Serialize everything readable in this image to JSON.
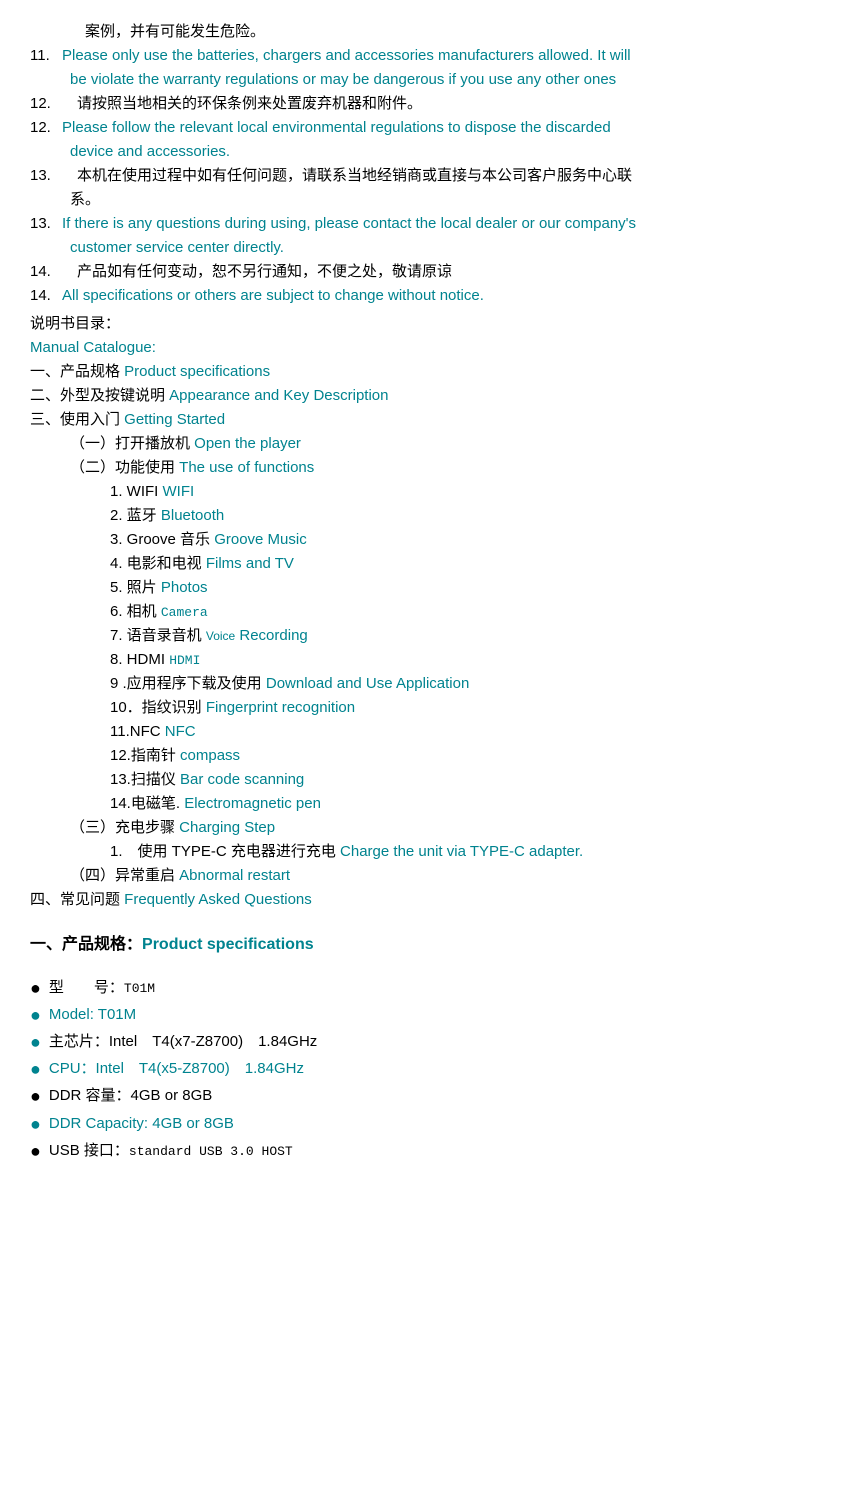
{
  "lines": [
    {
      "id": "l1",
      "indent": 0,
      "text_black": "　案例，并有可能发生危险。",
      "text_teal": ""
    },
    {
      "id": "l2",
      "indent": 0,
      "num": "11.",
      "text_black": "Please only use the batteries, chargers and accessories manufacturers allowed. It will",
      "text_teal": "",
      "color": "teal"
    },
    {
      "id": "l3",
      "indent": 1,
      "text_black": "",
      "text_teal": "be violate the warranty regulations or may be dangerous if you use any other ones",
      "color": "teal"
    },
    {
      "id": "l4",
      "indent": 0,
      "num": "12.",
      "text_black": "　请按照当地相关的环保条例来处置废弃机器和附件。",
      "text_teal": ""
    },
    {
      "id": "l5",
      "indent": 0,
      "num": "12.",
      "text_black": "Please follow the relevant local environmental regulations to dispose the discarded",
      "text_teal": "",
      "color": "teal"
    },
    {
      "id": "l6",
      "indent": 1,
      "text_black": "",
      "text_teal": "device and accessories.",
      "color": "teal"
    },
    {
      "id": "l7",
      "indent": 0,
      "num": "13.",
      "text_black": "　本机在使用过程中如有任何问题，请联系当地经销商或直接与本公司客户服务中心联",
      "text_teal": ""
    },
    {
      "id": "l8",
      "indent": 1,
      "text_black": "系。",
      "text_teal": ""
    },
    {
      "id": "l9",
      "indent": 0,
      "num": "13.",
      "text_black": "If there is any questions during using, please contact the local dealer or our company's",
      "text_teal": "",
      "color": "teal"
    },
    {
      "id": "l10",
      "indent": 1,
      "text_black": "",
      "text_teal": "customer service center directly.",
      "color": "teal"
    },
    {
      "id": "l11",
      "indent": 0,
      "num": "14.",
      "text_black": "　产品如有任何变动，恕不另行通知，不便之处，敬请原谅",
      "text_teal": ""
    },
    {
      "id": "l12",
      "indent": 0,
      "num": "14.",
      "text_black": "All specifications or others are subject to change without notice.",
      "text_teal": "",
      "color": "teal"
    },
    {
      "id": "l13",
      "indent": 0,
      "text_black": "说明书目录：",
      "text_teal": ""
    },
    {
      "id": "l14",
      "indent": 0,
      "text_black": "",
      "text_teal": "Manual Catalogue:",
      "color": "teal"
    },
    {
      "id": "l15",
      "indent": 0,
      "text_black": "一、产品规格  ",
      "text_teal": "Product specifications"
    },
    {
      "id": "l16",
      "indent": 0,
      "text_black": "二、外型及按键说明 ",
      "text_teal": "Appearance and Key Description"
    },
    {
      "id": "l17",
      "indent": 0,
      "text_black": "三、使用入门   ",
      "text_teal": "Getting Started"
    },
    {
      "id": "l18",
      "indent": 1,
      "text_black": "（一）打开播放机 ",
      "text_teal": "Open the player"
    },
    {
      "id": "l19",
      "indent": 1,
      "text_black": "（二）功能使用   ",
      "text_teal": "The use of functions"
    },
    {
      "id": "l20",
      "indent": 2,
      "num": "1.",
      "text_black": "WIFI   ",
      "text_teal": "WIFI"
    },
    {
      "id": "l21",
      "indent": 2,
      "num": "2.",
      "text_black": "蓝牙   ",
      "text_teal": "Bluetooth"
    },
    {
      "id": "l22",
      "indent": 2,
      "num": "3.",
      "text_black": "Groove  音乐 ",
      "text_teal": "Groove Music"
    },
    {
      "id": "l23",
      "indent": 2,
      "num": "4.",
      "text_black": "电影和电视   ",
      "text_teal": "Films and TV"
    },
    {
      "id": "l24",
      "indent": 2,
      "num": "5.",
      "text_black": "照片   ",
      "text_teal": "Photos"
    },
    {
      "id": "l25",
      "indent": 2,
      "num": "6.",
      "text_black": "相机 ",
      "text_teal": "Camera",
      "teal_mono": true
    },
    {
      "id": "l26",
      "indent": 2,
      "num": "7.",
      "text_black": "语音录音机   ",
      "text_teal": "Voice Recording",
      "teal_voice": true
    },
    {
      "id": "l27",
      "indent": 2,
      "num": "8.",
      "text_black": "HDMI        ",
      "text_teal": "HDMI",
      "teal_mono": true
    },
    {
      "id": "l28",
      "indent": 2,
      "num": "9 .",
      "text_black": "应用程序下载及使用   ",
      "text_teal": "Download and Use Application"
    },
    {
      "id": "l29",
      "indent": 2,
      "num": "10．",
      "text_black": "指纹识别   ",
      "text_teal": "Fingerprint recognition"
    },
    {
      "id": "l30",
      "indent": 2,
      "num": "11.NFC",
      "text_black": "     ",
      "text_teal": "NFC"
    },
    {
      "id": "l31",
      "indent": 2,
      "num": "12.指南针",
      "text_black": "   ",
      "text_teal": "compass"
    },
    {
      "id": "l32",
      "indent": 2,
      "num": "13.扫描仪",
      "text_black": "  ",
      "text_teal": "Bar code scanning"
    },
    {
      "id": "l33",
      "indent": 2,
      "num": "14.电磁笔.",
      "text_black": " ",
      "text_teal": "Electromagnetic pen"
    },
    {
      "id": "l34",
      "indent": 1,
      "text_black": "（三）充电步骤   ",
      "text_teal": "Charging Step"
    },
    {
      "id": "l35",
      "indent": 2,
      "num": "1.",
      "text_black": "　使用 TYPE-C 充电器进行充电   ",
      "text_teal": "Charge the unit via TYPE-C adapter."
    },
    {
      "id": "l36",
      "indent": 1,
      "text_black": "（四）异常重启   ",
      "text_teal": "Abnormal restart"
    },
    {
      "id": "l37",
      "indent": 0,
      "text_black": "四、常见问题      ",
      "text_teal": "Frequently Asked Questions"
    },
    {
      "id": "l38",
      "indent": 0,
      "text_black": "",
      "text_teal": ""
    },
    {
      "id": "l39",
      "indent": 0,
      "big": true,
      "text_black": "一、产品规格：",
      "text_teal": "Product specifications"
    }
  ],
  "bullets": [
    {
      "id": "b1",
      "teal": false,
      "text_black": "型　　号：T01M",
      "text_teal": "",
      "mono_black": true
    },
    {
      "id": "b2",
      "teal": true,
      "text_black": "",
      "text_teal": "Model: T01M"
    },
    {
      "id": "b3",
      "teal": true,
      "text_black": "主芯片：Intel　T4(x7-Z8700)　1.84GHz",
      "text_teal": ""
    },
    {
      "id": "b4",
      "teal": true,
      "text_black": "",
      "text_teal": "CPU：Intel　T4(x5-Z8700)　1.84GHz"
    },
    {
      "id": "b5",
      "teal": false,
      "text_black": "DDR 容量：4GB or 8GB",
      "text_teal": ""
    },
    {
      "id": "b6",
      "teal": true,
      "text_black": "",
      "text_teal": "DDR Capacity: 4GB or 8GB"
    },
    {
      "id": "b7",
      "teal": false,
      "text_black": "USB 接口：",
      "text_teal": "",
      "mono_end": "standard USB 3.0 HOST"
    }
  ]
}
